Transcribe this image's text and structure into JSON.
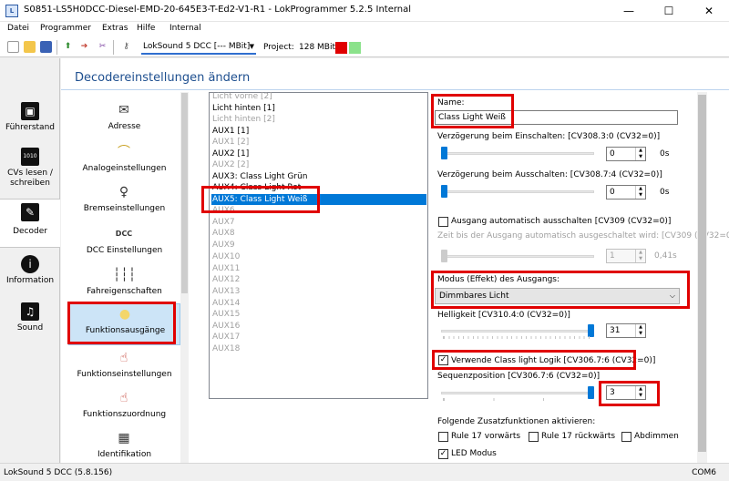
{
  "window": {
    "title": "S0851-LS5H0DCC-Diesel-EMD-20-645E3-T-Ed2-V1-R1 - LokProgrammer 5.2.5 Internal",
    "minimize": "—",
    "maximize": "☐",
    "close": "✕"
  },
  "menu": [
    "Datei",
    "Programmer",
    "Extras",
    "Hilfe",
    "Internal"
  ],
  "toolbar": {
    "decoder": "LokSound 5 DCC [--- MBit]",
    "project_label": "Project:",
    "project_size": "128 MBit",
    "colors": {
      "red": "#e00000",
      "green": "#8be28b"
    }
  },
  "leftnav": [
    {
      "label": "Führerstand",
      "icon": "cab-icon"
    },
    {
      "label": "CVs lesen / schreiben",
      "icon": "binary-icon"
    },
    {
      "label": "Decoder",
      "icon": "wrench-icon"
    },
    {
      "label": "Information",
      "icon": "info-icon"
    },
    {
      "label": "Sound",
      "icon": "music-icon"
    }
  ],
  "header": {
    "title": "Decodereinstellungen ändern"
  },
  "categories": [
    {
      "label": "Adresse",
      "icon": "envelope-icon"
    },
    {
      "label": "Analogeinstellungen",
      "icon": "analog-icon"
    },
    {
      "label": "Bremseinstellungen",
      "icon": "brake-icon"
    },
    {
      "label": "DCC Einstellungen",
      "icon": "dcc-icon",
      "icon_text": "DCC"
    },
    {
      "label": "Fahreigenschaften",
      "icon": "sliders-icon"
    },
    {
      "label": "Funktionsausgänge",
      "icon": "lightbulb-icon"
    },
    {
      "label": "Funktionseinstellungen",
      "icon": "function-settings-icon"
    },
    {
      "label": "Funktionszuordnung",
      "icon": "function-mapping-icon"
    },
    {
      "label": "Identifikation",
      "icon": "id-icon"
    }
  ],
  "outputs": [
    "Licht vorne [2]",
    "Licht hinten [1]",
    "Licht hinten [2]",
    "AUX1 [1]",
    "AUX1 [2]",
    "AUX2 [1]",
    "AUX2 [2]",
    "AUX3: Class Light Grün",
    "AUX4: Class Light Rot",
    "AUX5: Class Light Weiß",
    "AUX6",
    "AUX7",
    "AUX8",
    "AUX9",
    "AUX10",
    "AUX11",
    "AUX12",
    "AUX13",
    "AUX14",
    "AUX15",
    "AUX16",
    "AUX17",
    "AUX18"
  ],
  "settings": {
    "name_label": "Name:",
    "name_value": "Class Light Weiß",
    "delay_on_label": "Verzögerung beim Einschalten: [CV308.3:0 (CV32=0)]",
    "delay_on_value": "0",
    "delay_on_unit": "0s",
    "delay_off_label": "Verzögerung beim Ausschalten: [CV308.7:4 (CV32=0)]",
    "delay_off_value": "0",
    "delay_off_unit": "0s",
    "auto_off_label": "Ausgang automatisch ausschalten [CV309 (CV32=0)]",
    "auto_off_time_label": "Zeit bis der Ausgang automatisch ausgeschaltet wird: [CV309 (CV32=0)]",
    "auto_off_time_value": "1",
    "auto_off_time_unit": "0,41s",
    "mode_label": "Modus (Effekt) des Ausgangs:",
    "mode_value": "Dimmbares Licht",
    "brightness_label": "Helligkeit [CV310.4:0 (CV32=0)]",
    "brightness_value": "31",
    "brightness_level": 1.0,
    "class_light_label": "Verwende Class light Logik [CV306.7:6 (CV32=0)]",
    "class_light_checked": "✓",
    "sequence_label": "Sequenzposition [CV306.7:6 (CV32=0)]",
    "sequence_value": "3",
    "sequence_level": 1.0,
    "extra_functions_label": "Folgende Zusatzfunktionen aktivieren:",
    "rule17_fwd": "Rule 17 vorwärts",
    "rule17_rev": "Rule 17 rückwärts",
    "dimming": "Abdimmen",
    "led_mode": "LED Modus",
    "led_checked": "✓"
  },
  "status": {
    "left": "LokSound 5 DCC (5.8.156)",
    "right": "COM6"
  }
}
